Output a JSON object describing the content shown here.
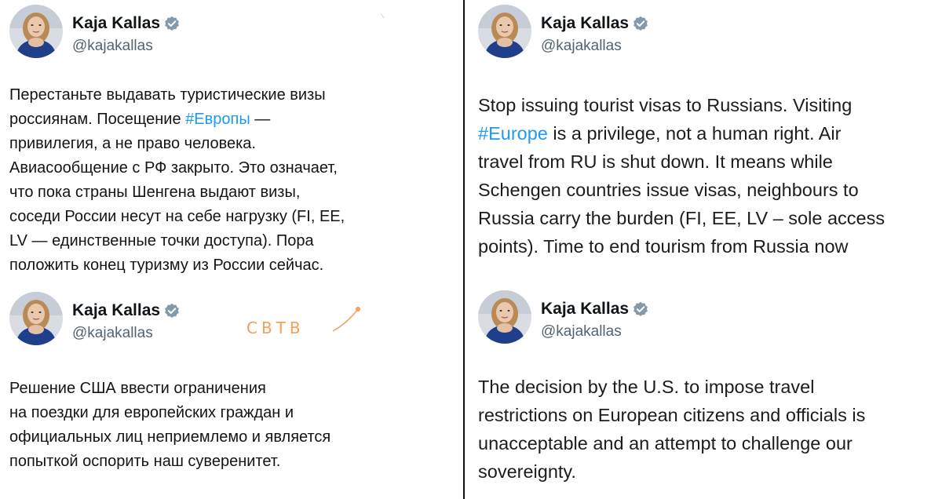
{
  "author": {
    "name": "Kaja Kallas",
    "handle": "@kajakallas",
    "verified_color": "#829aab",
    "hashtag_color": "#1d9bf0"
  },
  "tweets": {
    "ru1": {
      "lines": [
        {
          "text": "Перестаньте выдавать туристические визы"
        },
        {
          "text": "россиянам. Посещение ",
          "tag": "#Европы",
          "after": " —"
        },
        {
          "text": "привилегия, а не право человека."
        },
        {
          "text": "Авиасообщение с РФ закрыто. Это означает,"
        },
        {
          "text": "что пока страны Шенгена выдают визы,"
        },
        {
          "text": "соседи России несут на себе нагрузку (FI, EE,"
        },
        {
          "text": "LV — единственные точки доступа). Пора"
        },
        {
          "text": "положить конец туризму из России сейчас."
        }
      ]
    },
    "en1": {
      "lines": [
        {
          "text": "Stop issuing tourist visas to Russians. Visiting"
        },
        {
          "text": "",
          "tag": "#Europe",
          "after": " is a privilege, not a human right. Air"
        },
        {
          "text": "travel from RU is shut down. It means while"
        },
        {
          "text": "Schengen countries issue visas, neighbours to"
        },
        {
          "text": "Russia carry the burden (FI, EE, LV – sole access"
        },
        {
          "text": "points). Time to end tourism from Russia now"
        }
      ]
    },
    "ru2": {
      "lines": [
        {
          "text": "Решение США ввести ограничения"
        },
        {
          "text": "на поездки для европейских граждан и"
        },
        {
          "text": "официальных лиц неприемлемо и является"
        },
        {
          "text": "попыткой оспорить наш суверенитет."
        }
      ]
    },
    "en2": {
      "lines": [
        {
          "text": "The decision by the U.S. to impose travel"
        },
        {
          "text": "restrictions on European citizens and officials is"
        },
        {
          "text": "unacceptable and an attempt to challenge our"
        },
        {
          "text": "sovereignty."
        }
      ]
    }
  },
  "watermark": {
    "text": "СВТВ",
    "color": "#f2a05a"
  }
}
